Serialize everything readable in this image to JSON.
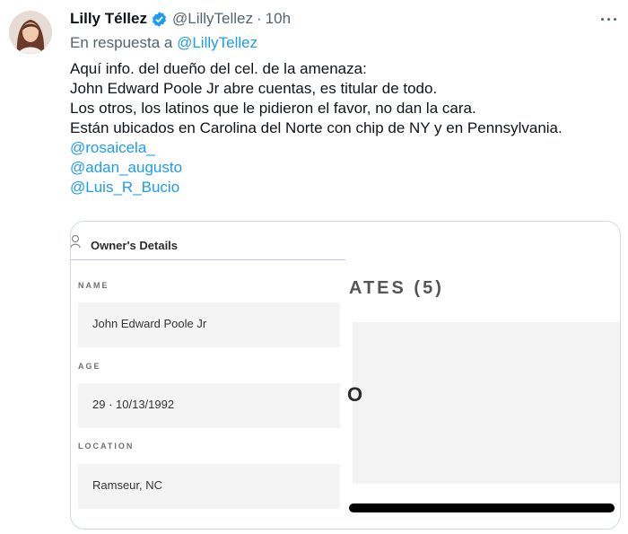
{
  "tweet": {
    "author_name": "Lilly Téllez",
    "handle": "@LillyTellez",
    "separator": "·",
    "time": "10h",
    "reply_prefix": "En respuesta a",
    "reply_to": "@LillyTellez",
    "lines": [
      "Aquí info. del dueño del cel. de la amenaza:",
      "John Edward Poole Jr abre cuentas, es titular de todo.",
      "Los otros, los latinos que le pidieron el favor, no dan la cara.",
      "Están ubicados en Carolina del Norte con chip de NY y en Pennsylvania."
    ],
    "mentions": [
      "@rosaicela_",
      "@adan_augusto",
      "@Luis_R_Bucio"
    ]
  },
  "image": {
    "panel_title": "Owner's Details",
    "fields": [
      {
        "label": "NAME",
        "value": "John Edward Poole Jr"
      },
      {
        "label": "AGE",
        "value": "29 · 10/13/1992"
      },
      {
        "label": "LOCATION",
        "value": "Ramseur, NC"
      }
    ],
    "right_heading": "ATES (5)",
    "right_letter": "O"
  },
  "colors": {
    "link": "#1d9bf0",
    "muted": "#536471",
    "verified": "#1d9bf0"
  }
}
